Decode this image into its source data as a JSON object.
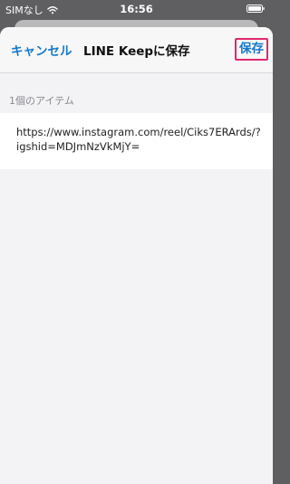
{
  "status_bar": {
    "carrier": "SIMなし",
    "time": "16:56"
  },
  "nav": {
    "cancel_label": "キャンセル",
    "title": "LINE Keepに保存",
    "save_label": "保存"
  },
  "list": {
    "section_header": "1個のアイテム",
    "items": [
      {
        "line1": "https://www.instagram.com/reel/Ciks7ERArds/?",
        "line2": "igshid=MDJmNzVkMjY="
      }
    ]
  },
  "colors": {
    "accent": "#1578c8",
    "highlight_border": "#e0286f"
  }
}
